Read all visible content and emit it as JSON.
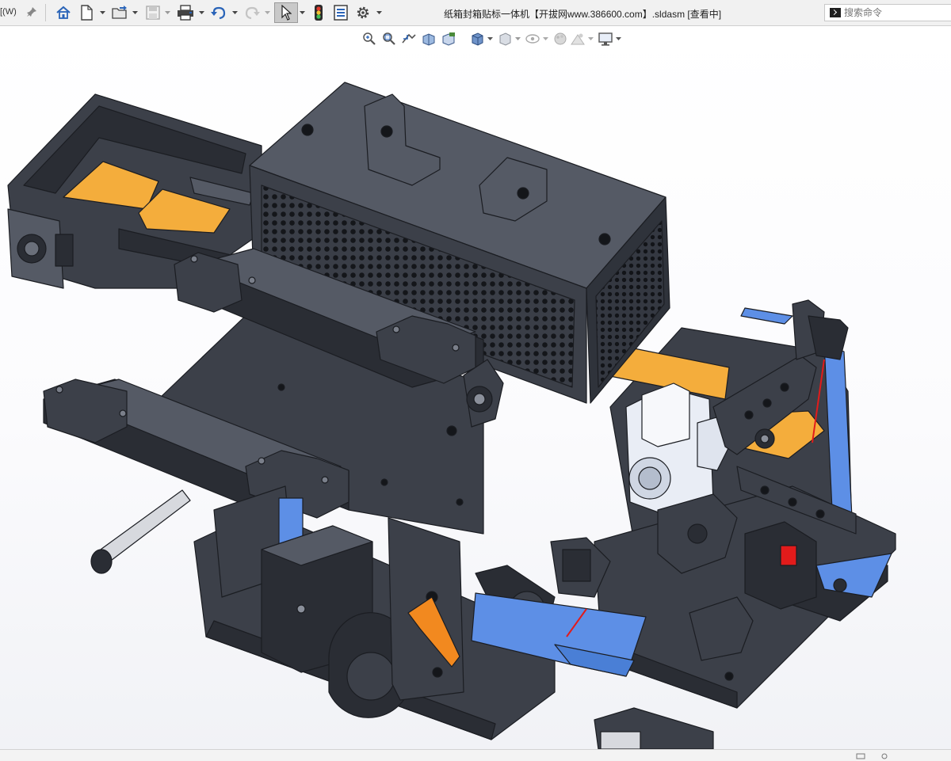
{
  "titlebar": {
    "menu_stub": "[(W)",
    "document_title": "纸箱封箱贴标一体机【开拔网www.386600.com】.sldasm [查看中]"
  },
  "toolbar": {
    "buttons": [
      {
        "name": "home-icon"
      },
      {
        "name": "new-document-icon"
      },
      {
        "name": "open-folder-icon"
      },
      {
        "name": "save-icon"
      },
      {
        "name": "print-icon"
      },
      {
        "name": "undo-icon"
      },
      {
        "name": "redo-icon"
      },
      {
        "name": "select-cursor-icon"
      },
      {
        "name": "rebuild-traffic-light-icon"
      },
      {
        "name": "file-properties-icon"
      },
      {
        "name": "options-gear-icon"
      }
    ]
  },
  "search": {
    "placeholder": "搜索命令"
  },
  "heads_up_toolbar": {
    "buttons": [
      {
        "name": "zoom-to-fit-icon"
      },
      {
        "name": "zoom-to-area-icon"
      },
      {
        "name": "previous-view-icon"
      },
      {
        "name": "section-view-icon"
      },
      {
        "name": "dynamic-annotation-icon"
      },
      {
        "name": "view-orientation-icon"
      },
      {
        "name": "display-style-icon"
      },
      {
        "name": "hide-show-items-icon"
      },
      {
        "name": "edit-appearance-icon"
      },
      {
        "name": "apply-scene-icon"
      },
      {
        "name": "view-settings-icon"
      }
    ]
  },
  "colors": {
    "toolbar_bg": "#f1f1f1",
    "part_dark": "#3c4049",
    "part_top": "#555a65",
    "part_edge": "#1b1d22",
    "tape_orange": "#f4ad3c",
    "belt_blue": "#5d8fe6",
    "lever_orange": "#f2891f",
    "sensor_red": "#e21b1b",
    "clamp_white": "#e9edf5"
  }
}
